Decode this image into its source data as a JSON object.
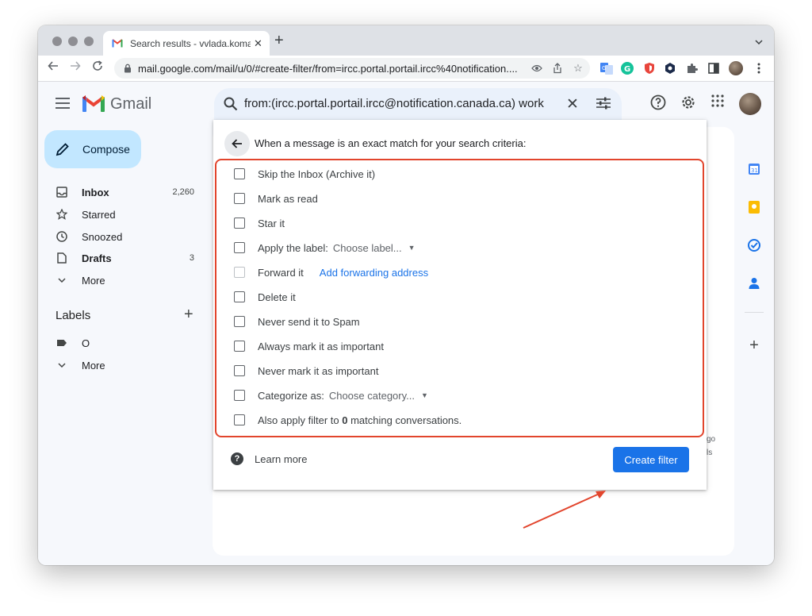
{
  "browser": {
    "tab_title": "Search results - vvlada.komar",
    "tab_close": "✕",
    "new_tab": "+",
    "url": "mail.google.com/mail/u/0/#create-filter/from=ircc.portal.portail.ircc%40notification...."
  },
  "gmail": {
    "app_name": "Gmail",
    "search_query": "from:(ircc.portal.portail.ircc@notification.canada.ca) work",
    "compose_label": "Compose",
    "nav": [
      {
        "label": "Inbox",
        "count": "2,260",
        "bold": true,
        "icon": "inbox-icon"
      },
      {
        "label": "Starred",
        "count": "",
        "bold": false,
        "icon": "star-icon"
      },
      {
        "label": "Snoozed",
        "count": "",
        "bold": false,
        "icon": "clock-icon"
      },
      {
        "label": "Drafts",
        "count": "3",
        "bold": true,
        "icon": "draft-icon"
      },
      {
        "label": "More",
        "count": "",
        "bold": false,
        "icon": "chevron-down-icon"
      }
    ],
    "labels_heading": "Labels",
    "labels_add": "+",
    "labels": [
      {
        "label": "O",
        "icon": "label-icon"
      },
      {
        "label": "More",
        "icon": "chevron-down-icon"
      }
    ],
    "side_fragments": [
      "go",
      "ls"
    ]
  },
  "filter": {
    "criteria_text": "When a message is an exact match for your search criteria:",
    "options": {
      "skip_inbox": "Skip the Inbox (Archive it)",
      "mark_read": "Mark as read",
      "star": "Star it",
      "apply_label": "Apply the label:",
      "apply_label_select": "Choose label...",
      "forward": "Forward it",
      "forward_link": "Add forwarding address",
      "delete": "Delete it",
      "never_spam": "Never send it to Spam",
      "always_important": "Always mark it as important",
      "never_important": "Never mark it as important",
      "categorize": "Categorize as:",
      "categorize_select": "Choose category...",
      "also_apply_prefix": "Also apply filter to",
      "also_apply_count": "0",
      "also_apply_suffix": "matching conversations."
    },
    "learn_more": "Learn more",
    "create_button": "Create filter"
  },
  "colors": {
    "accent_blue": "#1a73e8",
    "highlight_red": "#e2452d",
    "compose_bg": "#c2e7ff"
  }
}
